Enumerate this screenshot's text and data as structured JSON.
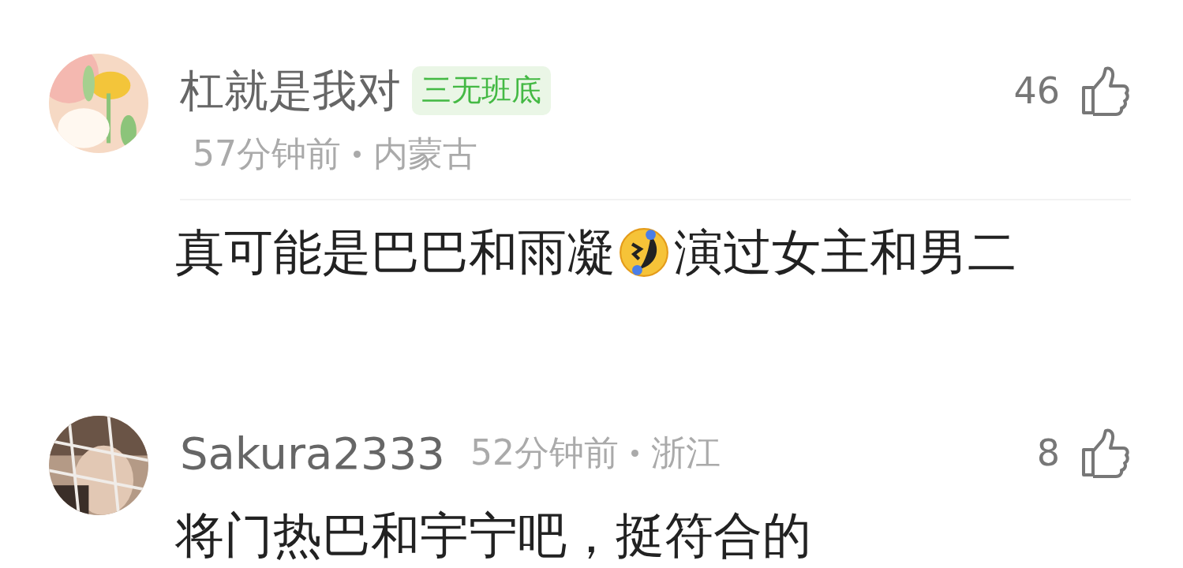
{
  "comments": [
    {
      "username": "杠就是我对",
      "badge": "三无班底",
      "meta_inline": false,
      "time": "57分钟前",
      "location": "内蒙古",
      "likes": "46",
      "divider": true,
      "body": [
        {
          "kind": "text",
          "text": "真可能是巴巴和雨凝"
        },
        {
          "kind": "emoji"
        },
        {
          "kind": "text",
          "text": "演过女主和男二"
        }
      ]
    },
    {
      "username": "Sakura2333",
      "meta_inline": true,
      "time": "52分钟前",
      "location": "浙江",
      "likes": "8",
      "divider": false,
      "body": [
        {
          "kind": "text",
          "text": "将门热巴和宇宁吧，挺符合的"
        }
      ]
    }
  ]
}
